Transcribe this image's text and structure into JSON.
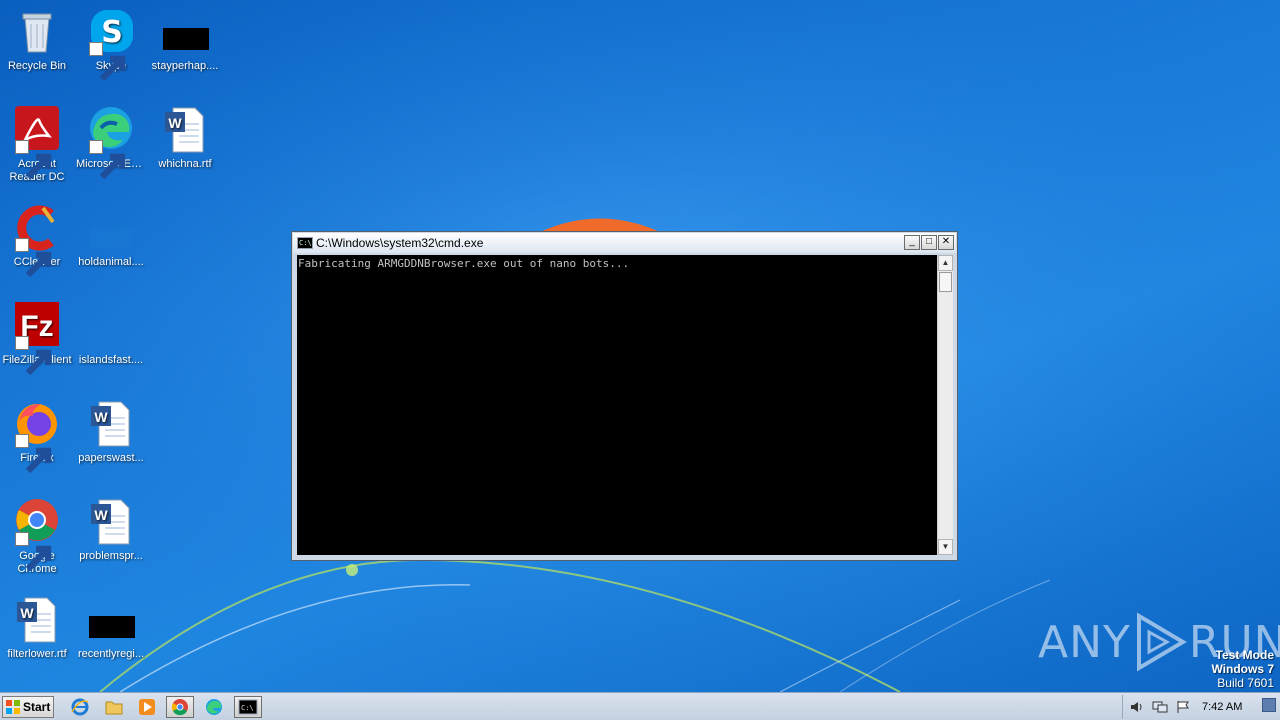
{
  "desktop": {
    "icons": [
      {
        "label": "Recycle Bin",
        "icon": "recycle-bin-icon"
      },
      {
        "label": "Skype",
        "icon": "skype-icon"
      },
      {
        "label": "stayperhap....",
        "icon": "redacted-file-icon"
      },
      {
        "label": "Acrobat Reader DC",
        "icon": "acrobat-icon"
      },
      {
        "label": "Microsoft Edge",
        "icon": "edge-icon"
      },
      {
        "label": "whichna.rtf",
        "icon": "word-document-icon"
      },
      {
        "label": "CCleaner",
        "icon": "ccleaner-icon"
      },
      {
        "label": "holdanimal....",
        "icon": "blank-file-icon"
      },
      {
        "label": "FileZilla Client",
        "icon": "filezilla-icon"
      },
      {
        "label": "islandsfast....",
        "icon": "blank-file-icon"
      },
      {
        "label": "Firefox",
        "icon": "firefox-icon"
      },
      {
        "label": "paperswast...",
        "icon": "word-document-icon"
      },
      {
        "label": "Google Chrome",
        "icon": "chrome-icon"
      },
      {
        "label": "problemspr...",
        "icon": "word-document-icon"
      },
      {
        "label": "filterlower.rtf",
        "icon": "word-document-icon"
      },
      {
        "label": "recentlyregi...",
        "icon": "redacted-file-icon"
      }
    ]
  },
  "cmd_window": {
    "title": "C:\\Windows\\system32\\cmd.exe",
    "output": "Fabricating ARMGDDNBrowser.exe out of nano bots...",
    "minimize_label": "_",
    "maximize_label": "□",
    "close_label": "✕"
  },
  "watermark": {
    "left": "ANY",
    "right": "RUN"
  },
  "system_info": {
    "mode": "Test Mode",
    "os": "Windows 7",
    "build": "Build 7601"
  },
  "taskbar": {
    "start_label": "Start",
    "pinned": [
      "internet-explorer-icon",
      "file-explorer-icon",
      "media-player-icon",
      "chrome-icon",
      "edge-icon",
      "cmd-icon"
    ],
    "clock": "7:42 AM"
  },
  "colors": {
    "desktop_blue": "#1877d6",
    "cmd_background": "#000000",
    "cmd_text": "#c0c0c0"
  }
}
